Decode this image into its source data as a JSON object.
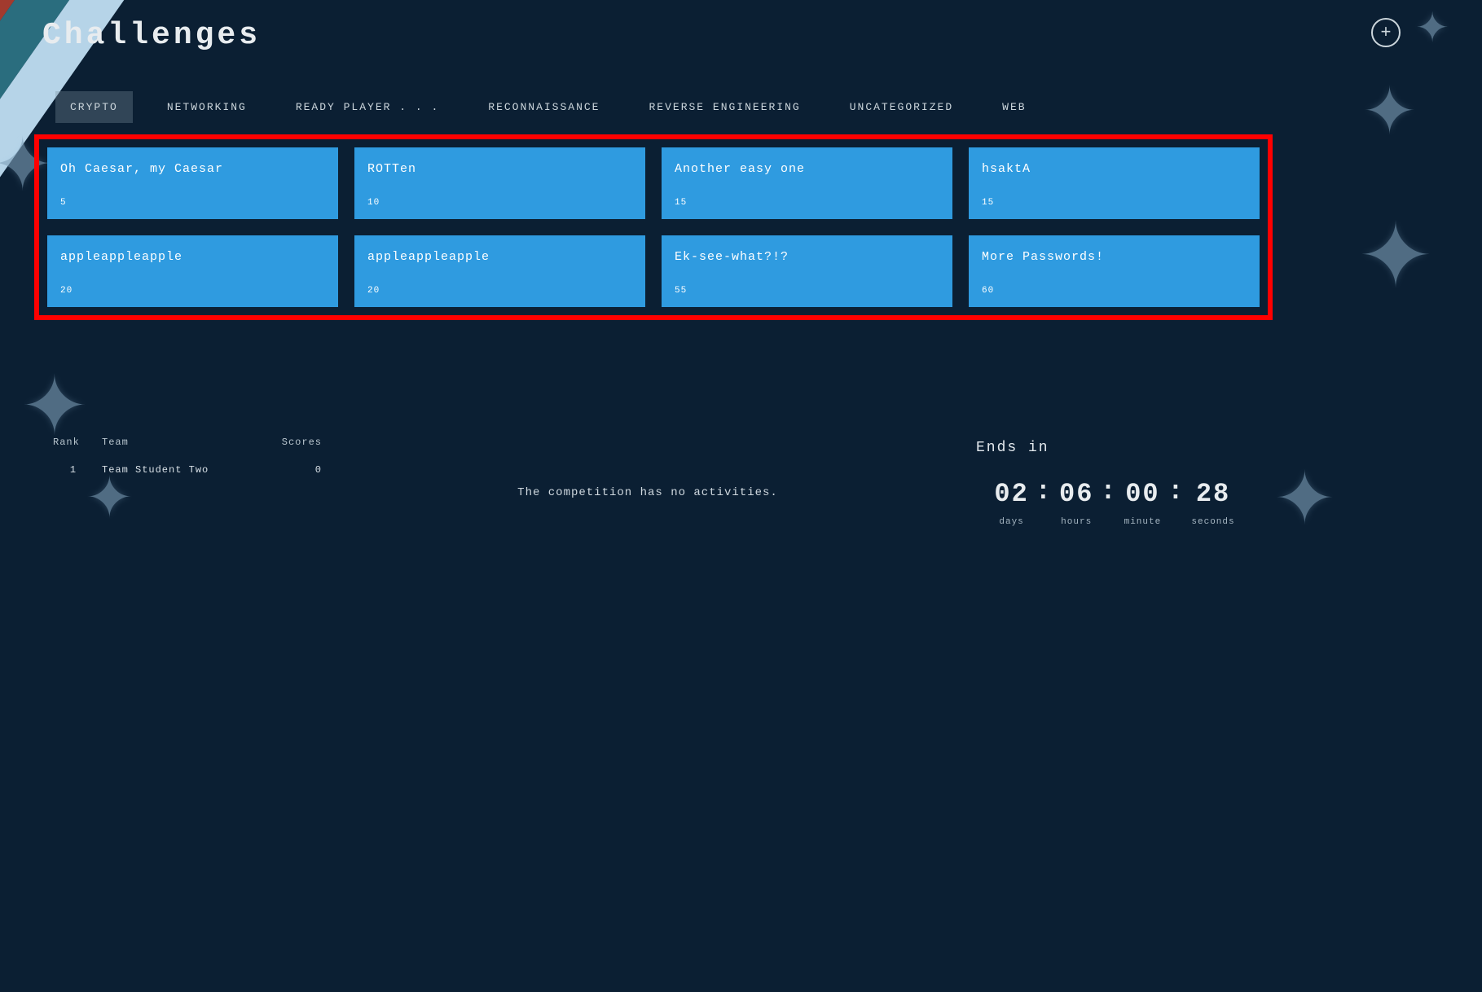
{
  "page_title": "Challenges",
  "plus_glyph": "+",
  "tabs": {
    "items": [
      {
        "label": "CRYPTO",
        "active": true
      },
      {
        "label": "NETWORKING",
        "active": false
      },
      {
        "label": "READY PLAYER . . .",
        "active": false
      },
      {
        "label": "RECONNAISSANCE",
        "active": false
      },
      {
        "label": "REVERSE ENGINEERING",
        "active": false
      },
      {
        "label": "UNCATEGORIZED",
        "active": false
      },
      {
        "label": "WEB",
        "active": false
      }
    ]
  },
  "challenges": [
    {
      "title": "Oh Caesar, my Caesar",
      "points": "5"
    },
    {
      "title": "ROTTen",
      "points": "10"
    },
    {
      "title": "Another easy one",
      "points": "15"
    },
    {
      "title": "hsaktA",
      "points": "15"
    },
    {
      "title": "appleappleapple",
      "points": "20"
    },
    {
      "title": "appleappleapple",
      "points": "20"
    },
    {
      "title": "Ek-see-what?!?",
      "points": "55"
    },
    {
      "title": "More Passwords!",
      "points": "60"
    }
  ],
  "scoreboard": {
    "headers": {
      "rank": "Rank",
      "team": "Team",
      "scores": "Scores"
    },
    "rows": [
      {
        "rank": "1",
        "team": "Team Student Two",
        "score": "0"
      }
    ]
  },
  "activities": {
    "empty_message": "The competition has no activities."
  },
  "countdown": {
    "title": "Ends in",
    "days": "02",
    "hours": "06",
    "minutes": "00",
    "seconds": "28",
    "labels": {
      "days": "days",
      "hours": "hours",
      "minutes": "minute",
      "seconds": "seconds"
    },
    "sep": ":"
  },
  "colors": {
    "card_bg": "#2f9be0",
    "highlight_border": "#ff0000",
    "background": "#0b1f33"
  }
}
